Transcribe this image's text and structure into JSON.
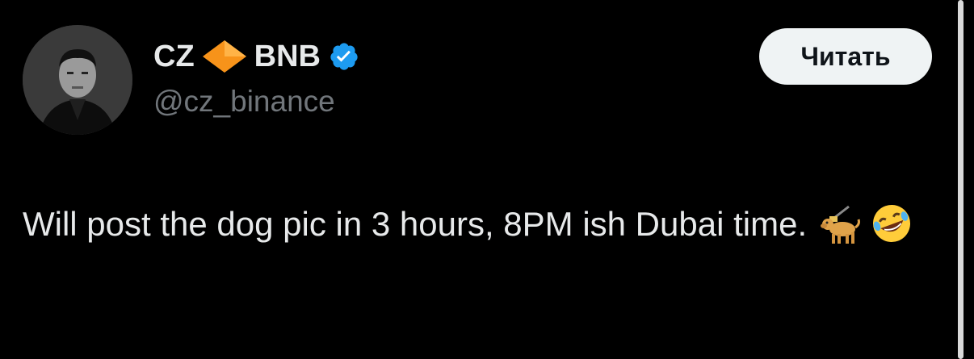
{
  "author": {
    "name": "CZ",
    "name_suffix": "BNB",
    "handle": "@cz_binance",
    "verified": true,
    "diamond_icon": "orange-diamond-icon",
    "verified_icon": "verified-badge-icon"
  },
  "follow_button": {
    "label": "Читать"
  },
  "tweet": {
    "text": "Will post the dog pic in 3 hours, 8PM ish Dubai time.",
    "emojis": [
      "guide-dog-emoji",
      "rolling-on-floor-laughing-emoji"
    ]
  },
  "colors": {
    "background": "#000000",
    "text_primary": "#e7e9ea",
    "text_secondary": "#71767b",
    "verified_blue": "#1d9bf0",
    "diamond_orange": "#f7931a",
    "button_bg": "#eff3f4"
  }
}
